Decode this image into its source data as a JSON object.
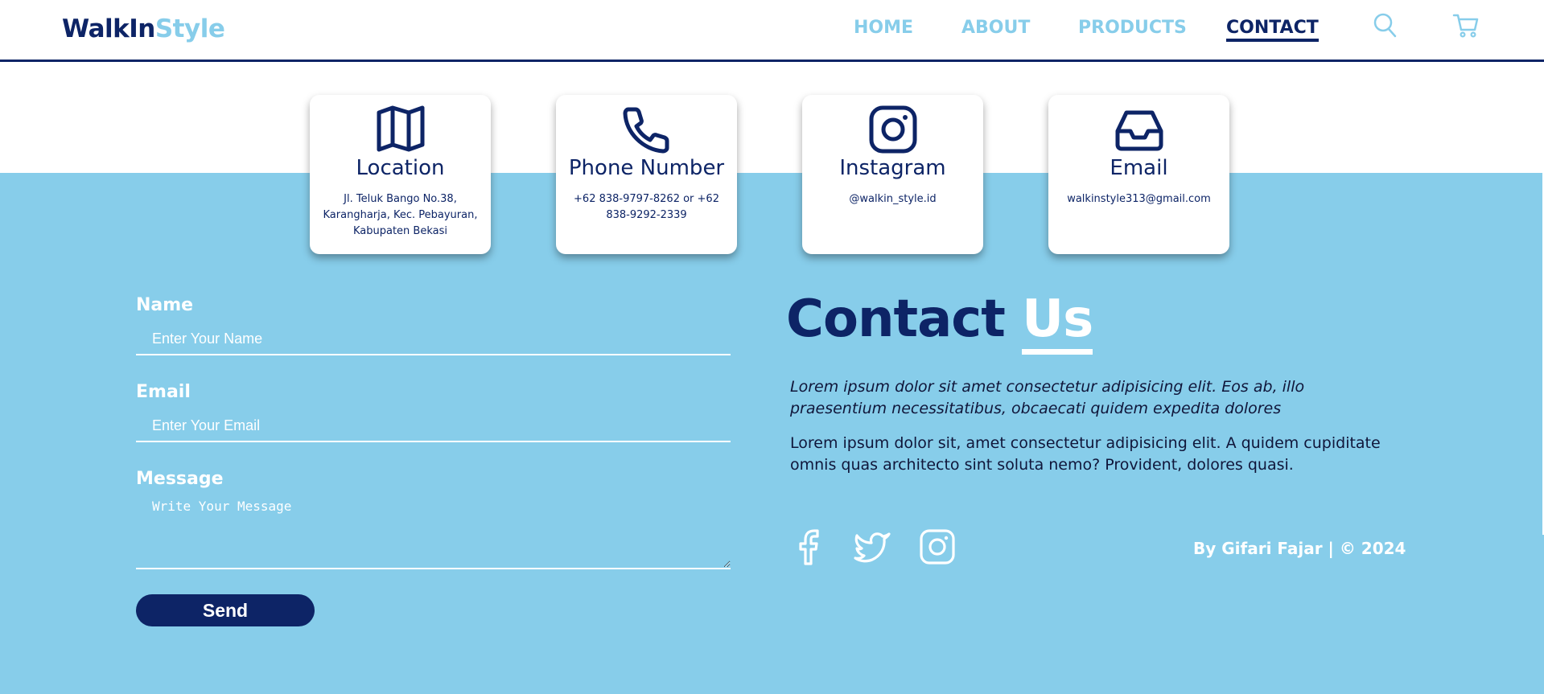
{
  "brand": {
    "part1": "WalkIn",
    "part2": "Style"
  },
  "nav": {
    "home": "HOME",
    "about": "ABOUT",
    "products": "PRODUCTS",
    "contact": "CONTACT",
    "active": "contact"
  },
  "header_icons": [
    "search-icon",
    "cart-icon"
  ],
  "cards": [
    {
      "icon": "map-icon",
      "title": "Location",
      "text": "Jl. Teluk Bango No.38, Karangharja, Kec. Pebayuran, Kabupaten Bekasi"
    },
    {
      "icon": "phone-icon",
      "title": "Phone Number",
      "text": "+62 838-9797-8262 or +62 838-9292-2339"
    },
    {
      "icon": "instagram-icon",
      "title": "Instagram",
      "text": "@walkin_style.id"
    },
    {
      "icon": "inbox-icon",
      "title": "Email",
      "text": "walkinstyle313@gmail.com"
    }
  ],
  "form": {
    "name_label": "Name",
    "name_placeholder": "Enter Your Name",
    "email_label": "Email",
    "email_placeholder": "Enter Your Email",
    "message_label": "Message",
    "message_placeholder": "Write Your Message",
    "send_label": "Send"
  },
  "contact": {
    "heading_part1": "Contact",
    "heading_part2": "Us",
    "paragraph1": "Lorem ipsum dolor sit amet consectetur adipisicing elit. Eos ab, illo praesentium necessitatibus, obcaecati quidem expedita dolores",
    "paragraph2": "Lorem ipsum dolor sit, amet consectetur adipisicing elit. A quidem cupiditate omnis quas architecto sint soluta nemo? Provident, dolores quasi.",
    "social_icons": [
      "facebook-icon",
      "twitter-icon",
      "instagram-icon"
    ],
    "credit": "By Gifari Fajar | © 2024"
  },
  "colors": {
    "navy": "#0d2466",
    "sky": "#87cdea",
    "white": "#ffffff"
  }
}
